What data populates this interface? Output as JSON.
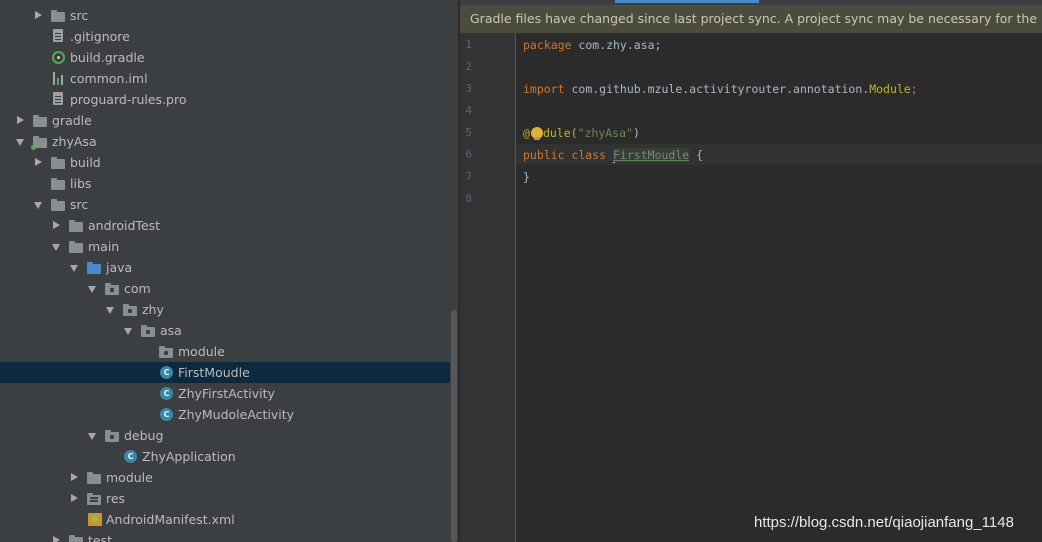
{
  "project_tree": {
    "rows": [
      {
        "label": "src",
        "icon": "folder-icon",
        "arrow": "right",
        "selected": false
      },
      {
        "label": ".gitignore",
        "icon": "text-file-icon",
        "arrow": "none",
        "selected": false
      },
      {
        "label": "build.gradle",
        "icon": "gradle-icon",
        "arrow": "none",
        "selected": false
      },
      {
        "label": "common.iml",
        "icon": "iml-file-icon",
        "arrow": "none",
        "selected": false
      },
      {
        "label": "proguard-rules.pro",
        "icon": "text-file-icon",
        "arrow": "none",
        "selected": false
      },
      {
        "label": "gradle",
        "icon": "folder-icon",
        "arrow": "right",
        "selected": false
      },
      {
        "label": "zhyAsa",
        "icon": "module-folder-icon",
        "arrow": "down",
        "selected": false
      },
      {
        "label": "build",
        "icon": "folder-icon",
        "arrow": "right",
        "selected": false
      },
      {
        "label": "libs",
        "icon": "folder-icon",
        "arrow": "none",
        "selected": false
      },
      {
        "label": "src",
        "icon": "folder-icon",
        "arrow": "down",
        "selected": false
      },
      {
        "label": "androidTest",
        "icon": "folder-icon",
        "arrow": "right",
        "selected": false
      },
      {
        "label": "main",
        "icon": "folder-icon",
        "arrow": "down",
        "selected": false
      },
      {
        "label": "java",
        "icon": "source-folder-icon",
        "arrow": "down",
        "selected": false
      },
      {
        "label": "com",
        "icon": "package-icon",
        "arrow": "down",
        "selected": false
      },
      {
        "label": "zhy",
        "icon": "package-icon",
        "arrow": "down",
        "selected": false
      },
      {
        "label": "asa",
        "icon": "package-icon",
        "arrow": "down",
        "selected": false
      },
      {
        "label": "module",
        "icon": "package-icon",
        "arrow": "none",
        "selected": false
      },
      {
        "label": "FirstMoudle",
        "icon": "class-icon",
        "arrow": "none",
        "selected": true
      },
      {
        "label": "ZhyFirstActivity",
        "icon": "class-icon",
        "arrow": "none",
        "selected": false
      },
      {
        "label": "ZhyMudoleActivity",
        "icon": "class-icon",
        "arrow": "none",
        "selected": false
      },
      {
        "label": "debug",
        "icon": "package-icon",
        "arrow": "down",
        "selected": false
      },
      {
        "label": "ZhyApplication",
        "icon": "class-icon",
        "arrow": "none",
        "selected": false
      },
      {
        "label": "module",
        "icon": "folder-icon",
        "arrow": "right",
        "selected": false
      },
      {
        "label": "res",
        "icon": "res-folder-icon",
        "arrow": "right",
        "selected": false
      },
      {
        "label": "AndroidManifest.xml",
        "icon": "manifest-icon",
        "arrow": "none",
        "selected": false
      },
      {
        "label": "test",
        "icon": "folder-icon",
        "arrow": "right",
        "selected": false
      }
    ]
  },
  "banner": {
    "text": "Gradle files have changed since last project sync. A project sync may be necessary for the IDE to w"
  },
  "editor": {
    "line_numbers": [
      "1",
      "2",
      "3",
      "4",
      "5",
      "6",
      "7",
      "8"
    ],
    "line1": {
      "kw": "package",
      "rest": " com.zhy.asa;"
    },
    "line3": {
      "kw": "import",
      "rest": " com.github.mzule.activityrouter.annotation.",
      "cls": "Module",
      "semi": ";"
    },
    "line5": {
      "at": "@",
      "mid": "dule(",
      "str": "\"zhyAsa\"",
      "close": ")"
    },
    "line6": {
      "kw": "public class",
      "cls": "FirstMoudle",
      "rest": " {"
    },
    "line7": {
      "text": "}"
    }
  },
  "watermark": "https://blog.csdn.net/qiaojianfang_1148",
  "colors": {
    "panel_bg": "#3c3f41",
    "editor_bg": "#2b2b2b",
    "selection": "#0d293e",
    "banner_bg": "#4b4b3f",
    "keyword": "#cc7832",
    "string": "#6a8759",
    "annotation": "#bbb529"
  }
}
